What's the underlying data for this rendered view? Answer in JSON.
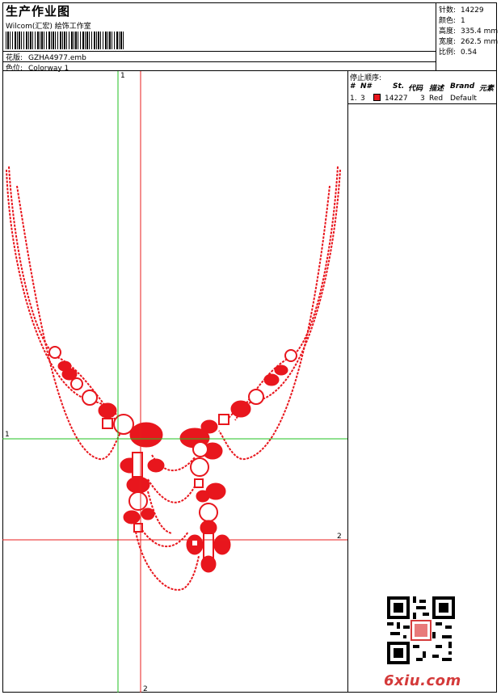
{
  "header": {
    "title": "生产作业图",
    "company": "Wilcom(汇宏) 絵饰工作室",
    "design_label": "花版:",
    "design_value": "GZHA4977.emb",
    "colorway_label": "色位:",
    "colorway_value": "Colorway 1"
  },
  "stats": [
    {
      "label": "针数:",
      "value": "14229"
    },
    {
      "label": "颜色:",
      "value": "1"
    },
    {
      "label": "高度:",
      "value": "335.4 mm"
    },
    {
      "label": "宽度:",
      "value": "262.5 mm"
    },
    {
      "label": "比例:",
      "value": "0.54"
    }
  ],
  "stop_sequence": {
    "title": "停止顺序:",
    "headers": [
      "#",
      "N#",
      "St.",
      "代码",
      "描述",
      "Brand",
      "元素"
    ],
    "rows": [
      {
        "index": "1.",
        "needle": "3",
        "stitches": "14227",
        "code": "3",
        "description": "Red",
        "brand": "Default",
        "swatch_color": "#e8161d"
      }
    ]
  },
  "guides": {
    "label_1": "1",
    "label_2": "2"
  },
  "watermark": "6xiu.com",
  "colors": {
    "design": "#e8161d",
    "guide_green": "#22c022",
    "guide_red": "#e81c1c"
  }
}
